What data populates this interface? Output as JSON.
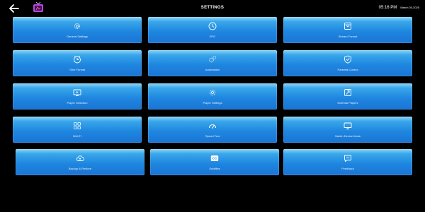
{
  "header": {
    "title": "SETTINGS",
    "time": "05:16 PM",
    "date": "March 30,2025",
    "back_icon": "arrow-left-icon",
    "logo_icon": "tv-logo-icon"
  },
  "colors": {
    "background": "#000000",
    "tile_top": "#8ed6f6",
    "tile_bottom": "#1a74d4"
  },
  "tiles": [
    {
      "label": "General Settings",
      "icon": "gear-icon"
    },
    {
      "label": "EPG",
      "icon": "clock-icon"
    },
    {
      "label": "Stream Format",
      "icon": "stream-format-icon"
    },
    {
      "label": "Time Format",
      "icon": "time-format-icon"
    },
    {
      "label": "Automation",
      "icon": "automation-gears-icon"
    },
    {
      "label": "Parental Control",
      "icon": "shield-check-icon"
    },
    {
      "label": "Player Selection",
      "icon": "player-screen-icon"
    },
    {
      "label": "Player Settings",
      "icon": "gear-icon"
    },
    {
      "label": "External Players",
      "icon": "external-player-icon"
    },
    {
      "label": "MULTI",
      "icon": "grid-icon"
    },
    {
      "label": "Speed Test",
      "icon": "speedometer-icon"
    },
    {
      "label": "Switch Device Mode",
      "icon": "device-mode-icon"
    },
    {
      "label": "Backup & Restore",
      "icon": "cloud-backup-icon"
    },
    {
      "label": "Subtitles",
      "icon": "cc-icon"
    },
    {
      "label": "Feedback",
      "icon": "feedback-icon"
    }
  ]
}
